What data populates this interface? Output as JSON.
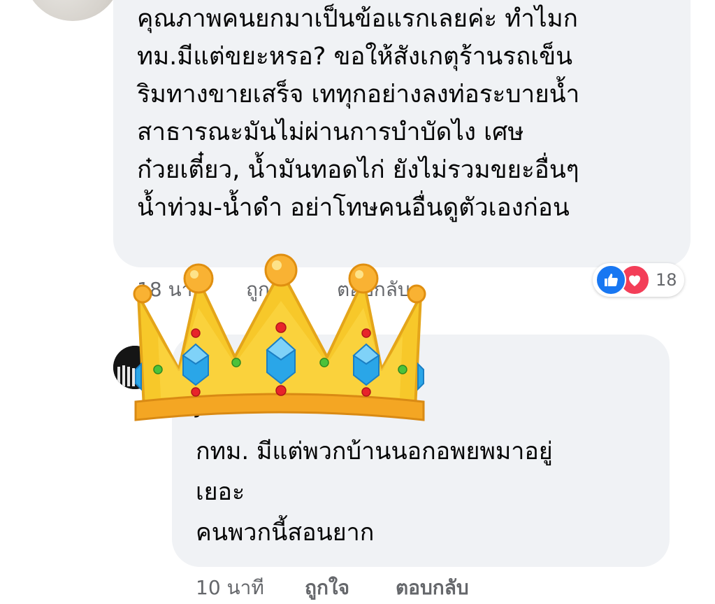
{
  "comment1": {
    "lines": [
      "คุณภาพคนยกมาเป็นข้อแรกเลยค่ะ ทำไมก",
      "ทม.มีแต่ขยะหรอ? ขอให้สังเกตุร้านรถเข็น",
      "ริมทางขายเสร็จ เททุกอย่างลงท่อระบายน้ำ",
      "สาธารณะมันไม่ผ่านการบำบัดไง เศษ",
      "ก๋วยเตี๋ยว, น้ำมันทอดไก่ ยังไม่รวมขยะอื่นๆ",
      "น้ำท่วม-น้ำดำ อย่าโทษคนอื่นดูตัวเองก่อน"
    ],
    "reaction_count": "18",
    "time": "18 นาที",
    "like_label": "ถูกใจ",
    "reply_label": "ตอบกลับ"
  },
  "comment2": {
    "author": "Jareerak Chonchai",
    "lines": [
      "กทม. มีแต่พวกบ้านนอกอพยพมาอยู่",
      "เยอะ",
      "คนพวกนี้สอนยาก"
    ],
    "time": "10 นาที",
    "like_label": "ถูกใจ",
    "reply_label": "ตอบกลับ"
  },
  "colors": {
    "bubble": "#f0f2f5",
    "meta_text": "#65676b",
    "like_blue": "#1877f2",
    "love_red": "#f33e58",
    "crown_gold": "#f7c82a",
    "gem_blue": "#2aa6e8"
  },
  "icons": {
    "like": "thumbs-up-icon",
    "love": "heart-icon",
    "sticker": "crown-icon"
  }
}
